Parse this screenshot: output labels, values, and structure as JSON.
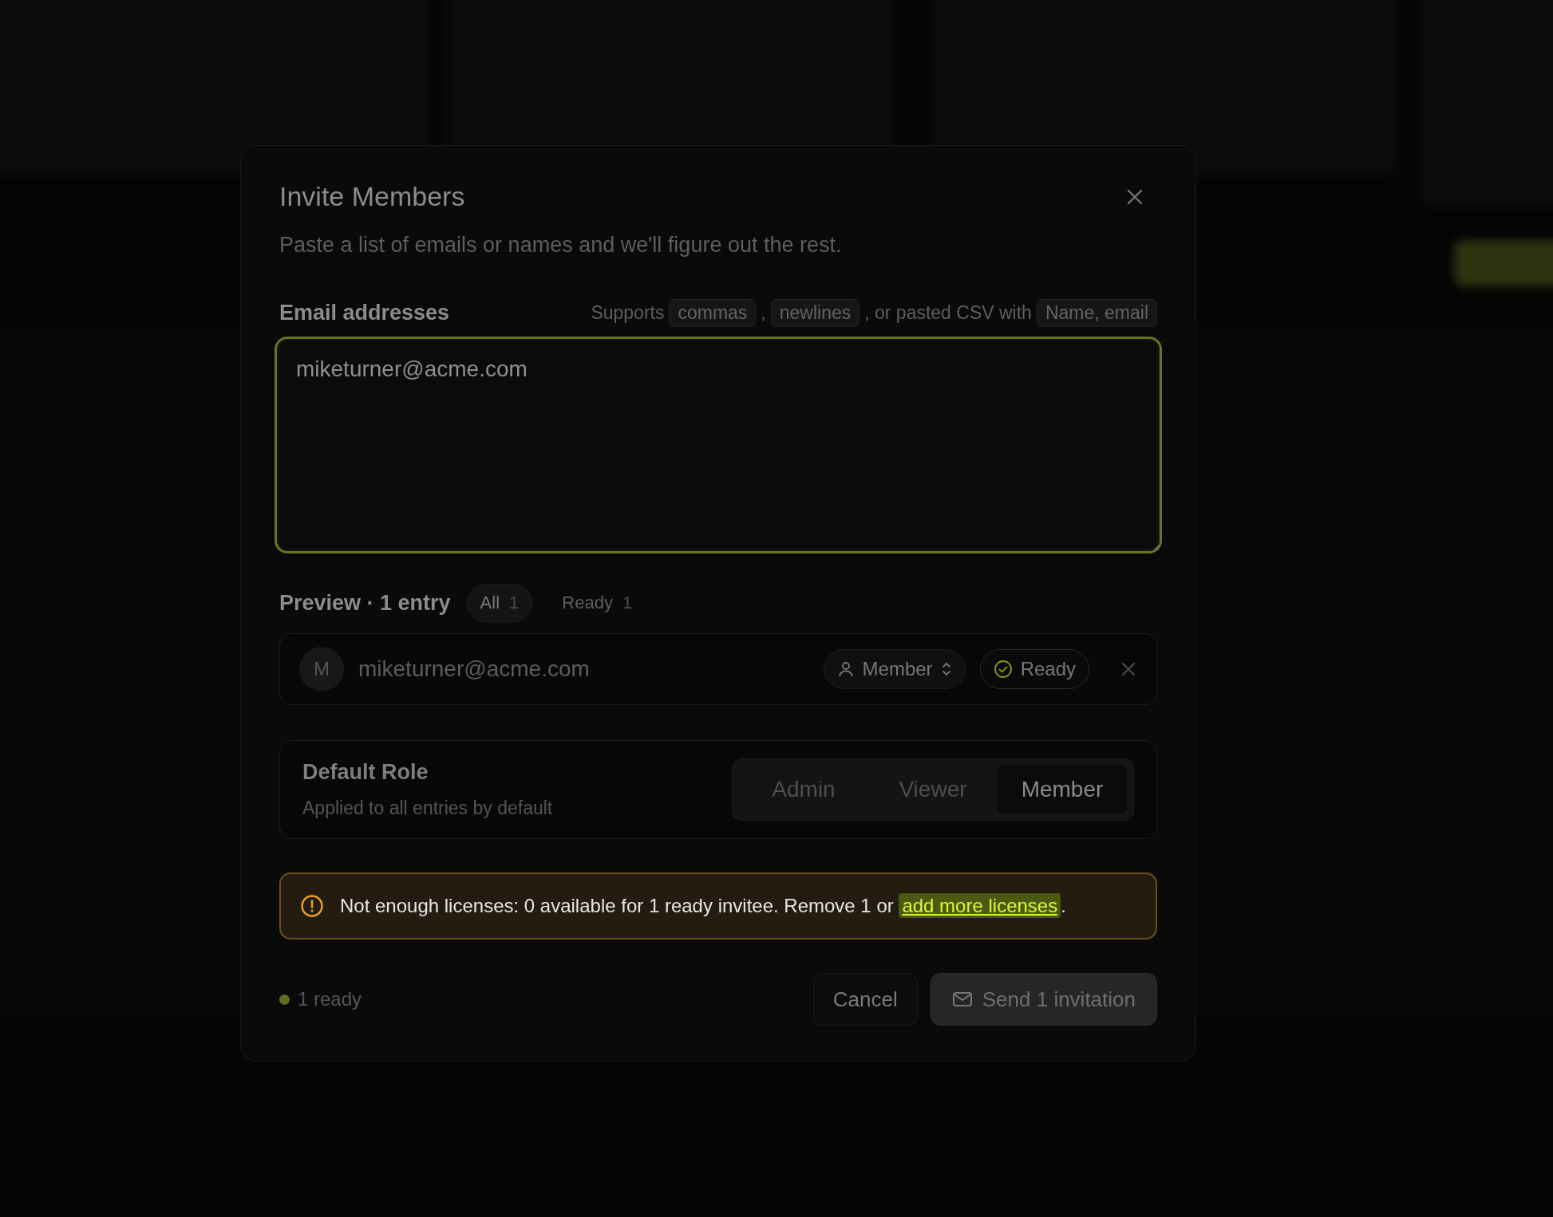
{
  "dialog": {
    "title": "Invite Members",
    "subtitle": "Paste a list of emails or names and we'll figure out the rest."
  },
  "email_field": {
    "label": "Email addresses",
    "hint_parts": [
      {
        "kind": "text",
        "text": "Supports"
      },
      {
        "kind": "chip",
        "text": "commas"
      },
      {
        "kind": "text",
        "text": ","
      },
      {
        "kind": "chip",
        "text": "newlines"
      },
      {
        "kind": "text",
        "text": ", or pasted CSV with"
      },
      {
        "kind": "chip",
        "text": "Name, email"
      }
    ],
    "value": "miketurner@acme.com",
    "focused": true
  },
  "preview": {
    "title": "Preview · 1 entry",
    "filters": [
      {
        "label": "All",
        "count": "1",
        "selected": true
      },
      {
        "label": "Ready",
        "count": "1",
        "selected": false
      }
    ],
    "entries": [
      {
        "avatar": "M",
        "email": "miketurner@acme.com",
        "role": "Member",
        "status": "Ready",
        "ready": true
      }
    ]
  },
  "default_role": {
    "title": "Default Role",
    "description": "Applied to all entries by default",
    "options": [
      {
        "label": "Admin",
        "selected": false
      },
      {
        "label": "Viewer",
        "selected": false
      },
      {
        "label": "Member",
        "selected": true
      }
    ]
  },
  "warning": {
    "text": "Not enough licenses: 0 available for 1 ready invitee. Remove 1 or ",
    "link": "add more licenses",
    "after": "."
  },
  "footer": {
    "ready_count": "1 ready",
    "buttons": [
      {
        "label": "Cancel",
        "kind": "secondary"
      },
      {
        "label": "Send 1 invitation",
        "kind": "primary"
      }
    ]
  }
}
